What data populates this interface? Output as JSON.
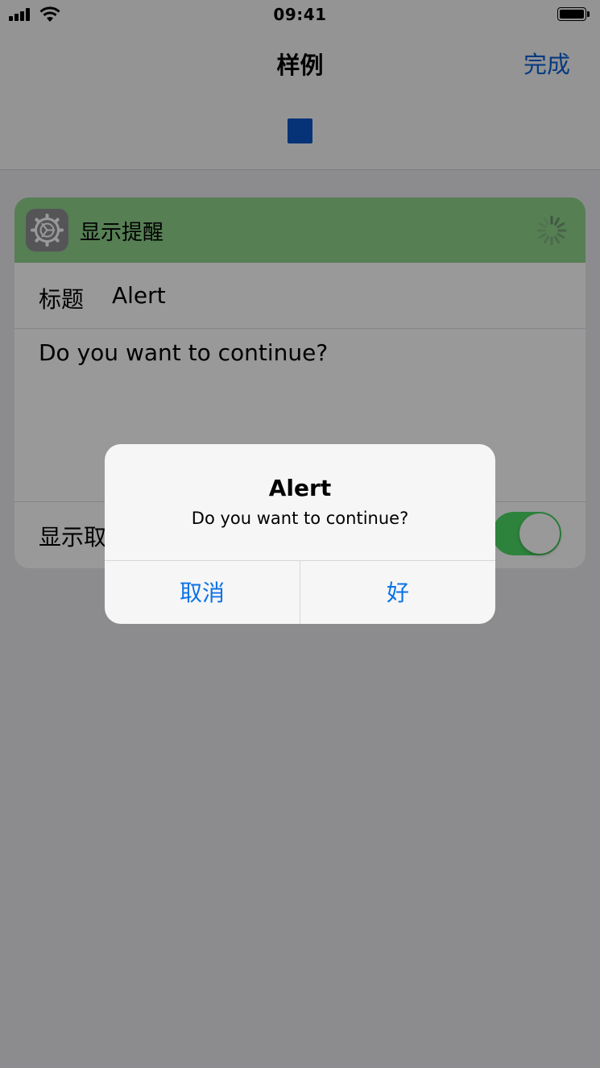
{
  "status_bar": {
    "time": "09:41"
  },
  "nav": {
    "title": "样例",
    "done_label": "完成"
  },
  "action": {
    "title": "显示提醒",
    "title_row_label": "标题",
    "title_row_value": "Alert",
    "message": "Do you want to continue?",
    "toggle_label": "显示取",
    "toggle_on": true
  },
  "alert": {
    "title": "Alert",
    "message": "Do you want to continue?",
    "cancel_label": "取消",
    "ok_label": "好"
  },
  "colors": {
    "accent": "#0a72e8",
    "header_green": "#8fd48d",
    "toggle_green": "#4cd964",
    "stop_blue": "#0a56c8"
  }
}
